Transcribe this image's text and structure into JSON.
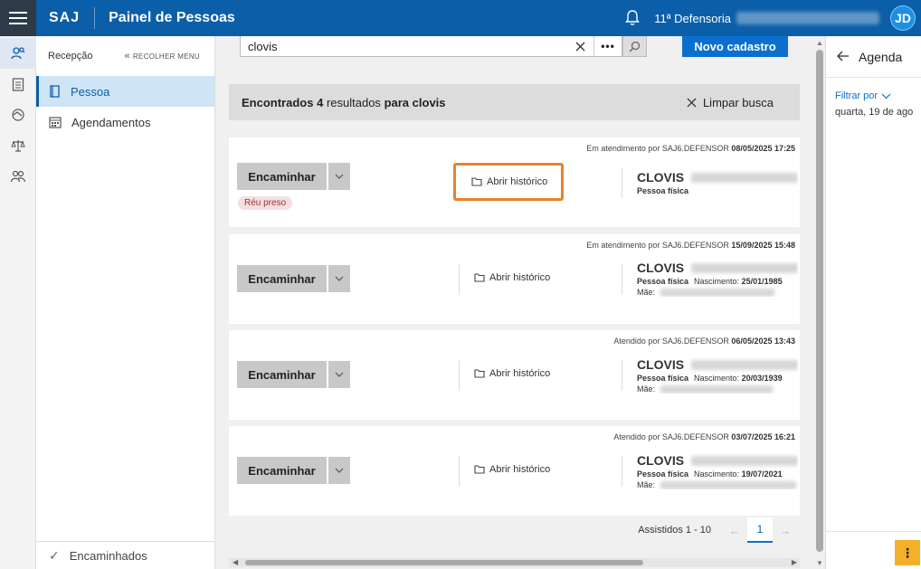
{
  "header": {
    "brand": "SAJ",
    "title": "Painel de Pessoas",
    "org": "11ª Defensoria",
    "avatar_initials": "JD"
  },
  "sidenav": {
    "section": "Recepção",
    "collapse_label": "RECOLHER MENU",
    "items": [
      {
        "label": "Pessoa",
        "active": true
      },
      {
        "label": "Agendamentos",
        "active": false
      }
    ],
    "footer": "Encaminhados"
  },
  "search": {
    "value": "clovis",
    "new_button": "Novo cadastro"
  },
  "results": {
    "prefix": "Encontrados",
    "count": "4",
    "middle": "resultados",
    "for": "para",
    "term": "clovis",
    "clear_label": "Limpar busca"
  },
  "cards": [
    {
      "status": "Em atendimento por SAJ6.DEFENSOR",
      "datetime": "08/05/2025 17:25",
      "forward_label": "Encaminhar",
      "tag": "Réu preso",
      "history_label": "Abrir histórico",
      "name": "CLOVIS",
      "type": "Pessoa física"
    },
    {
      "status": "Em atendimento por SAJ6.DEFENSOR",
      "datetime": "15/09/2025 15:48",
      "forward_label": "Encaminhar",
      "history_label": "Abrir histórico",
      "name": "CLOVIS",
      "type": "Pessoa física",
      "birth_label": "Nascimento:",
      "birth": "25/01/1985",
      "mother_label": "Mãe:"
    },
    {
      "status": "Atendido por SAJ6.DEFENSOR",
      "datetime": "06/05/2025 13:43",
      "forward_label": "Encaminhar",
      "history_label": "Abrir histórico",
      "name": "CLOVIS",
      "type": "Pessoa física",
      "birth_label": "Nascimento:",
      "birth": "20/03/1939",
      "mother_label": "Mãe:"
    },
    {
      "status": "Atendido por SAJ6.DEFENSOR",
      "datetime": "03/07/2025 16:21",
      "forward_label": "Encaminhar",
      "history_label": "Abrir histórico",
      "name": "CLOVIS",
      "type": "Pessoa física",
      "birth_label": "Nascimento:",
      "birth": "19/07/2021",
      "mother_label": "Mãe:"
    }
  ],
  "pager": {
    "range": "Assistidos 1 - 10",
    "current": "1"
  },
  "agenda": {
    "title": "Agenda",
    "filter_label": "Filtrar por",
    "date": "quarta, 19 de ago"
  },
  "colors": {
    "primary": "#0b5ea8",
    "button_blue": "#0b6fd0",
    "highlight": "#e8822a",
    "tag_red": "#a3312f",
    "fab": "#f5b02a"
  }
}
